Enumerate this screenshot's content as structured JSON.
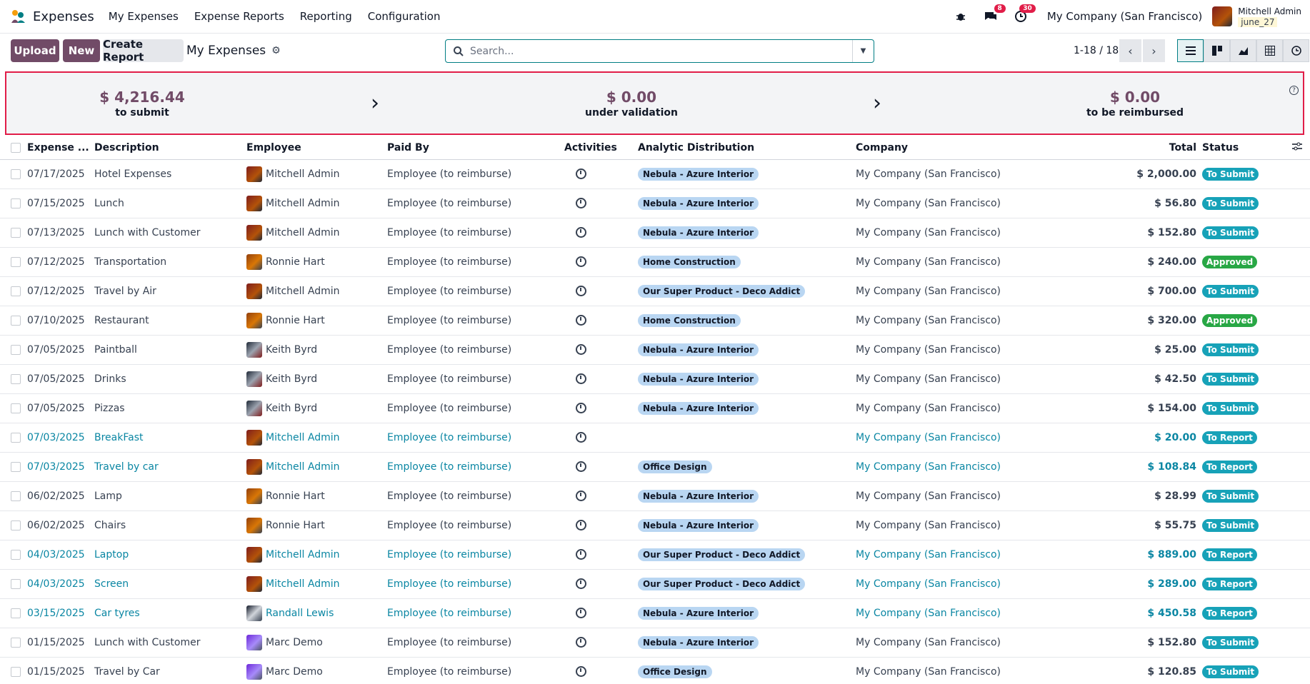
{
  "nav": {
    "app_name": "Expenses",
    "menu": [
      "My Expenses",
      "Expense Reports",
      "Reporting",
      "Configuration"
    ],
    "chat_badge": "8",
    "activity_badge": "30",
    "company": "My Company (San Francisco)",
    "user_name": "Mitchell Admin",
    "user_db": "june_27"
  },
  "control": {
    "upload_label": "Upload",
    "new_label": "New",
    "create_report_label": "Create Report",
    "breadcrumb": "My Expenses",
    "search_placeholder": "Search...",
    "pager": "1-18 / 18"
  },
  "summary": {
    "to_submit_amount": "$ 4,216.44",
    "to_submit_label": "to submit",
    "under_validation_amount": "$ 0.00",
    "under_validation_label": "under validation",
    "to_reimburse_amount": "$ 0.00",
    "to_reimburse_label": "to be reimbursed"
  },
  "table": {
    "headers": [
      "Expense ...",
      "Description",
      "Employee",
      "Paid By",
      "Activities",
      "Analytic Distribution",
      "Company",
      "Total",
      "Status"
    ],
    "rows": [
      {
        "date": "07/17/2025",
        "desc": "Hotel Expenses",
        "employee": "Mitchell Admin",
        "paid_by": "Employee (to reimburse)",
        "analytic": "Nebula - Azure Interior",
        "company": "My Company (San Francisco)",
        "total": "$ 2,000.00",
        "status": "To Submit"
      },
      {
        "date": "07/15/2025",
        "desc": "Lunch",
        "employee": "Mitchell Admin",
        "paid_by": "Employee (to reimburse)",
        "analytic": "Nebula - Azure Interior",
        "company": "My Company (San Francisco)",
        "total": "$ 56.80",
        "status": "To Submit"
      },
      {
        "date": "07/13/2025",
        "desc": "Lunch with Customer",
        "employee": "Mitchell Admin",
        "paid_by": "Employee (to reimburse)",
        "analytic": "Nebula - Azure Interior",
        "company": "My Company (San Francisco)",
        "total": "$ 152.80",
        "status": "To Submit"
      },
      {
        "date": "07/12/2025",
        "desc": "Transportation",
        "employee": "Ronnie Hart",
        "paid_by": "Employee (to reimburse)",
        "analytic": "Home Construction",
        "company": "My Company (San Francisco)",
        "total": "$ 240.00",
        "status": "Approved"
      },
      {
        "date": "07/12/2025",
        "desc": "Travel by Air",
        "employee": "Mitchell Admin",
        "paid_by": "Employee (to reimburse)",
        "analytic": "Our Super Product - Deco Addict",
        "company": "My Company (San Francisco)",
        "total": "$ 700.00",
        "status": "To Submit"
      },
      {
        "date": "07/10/2025",
        "desc": "Restaurant",
        "employee": "Ronnie Hart",
        "paid_by": "Employee (to reimburse)",
        "analytic": "Home Construction",
        "company": "My Company (San Francisco)",
        "total": "$ 320.00",
        "status": "Approved"
      },
      {
        "date": "07/05/2025",
        "desc": "Paintball",
        "employee": "Keith Byrd",
        "paid_by": "Employee (to reimburse)",
        "analytic": "Nebula - Azure Interior",
        "company": "My Company (San Francisco)",
        "total": "$ 25.00",
        "status": "To Submit"
      },
      {
        "date": "07/05/2025",
        "desc": "Drinks",
        "employee": "Keith Byrd",
        "paid_by": "Employee (to reimburse)",
        "analytic": "Nebula - Azure Interior",
        "company": "My Company (San Francisco)",
        "total": "$ 42.50",
        "status": "To Submit"
      },
      {
        "date": "07/05/2025",
        "desc": "Pizzas",
        "employee": "Keith Byrd",
        "paid_by": "Employee (to reimburse)",
        "analytic": "Nebula - Azure Interior",
        "company": "My Company (San Francisco)",
        "total": "$ 154.00",
        "status": "To Submit"
      },
      {
        "date": "07/03/2025",
        "desc": "BreakFast",
        "employee": "Mitchell Admin",
        "paid_by": "Employee (to reimburse)",
        "analytic": "",
        "company": "My Company (San Francisco)",
        "total": "$ 20.00",
        "status": "To Report"
      },
      {
        "date": "07/03/2025",
        "desc": "Travel by car",
        "employee": "Mitchell Admin",
        "paid_by": "Employee (to reimburse)",
        "analytic": "Office Design",
        "company": "My Company (San Francisco)",
        "total": "$ 108.84",
        "status": "To Report"
      },
      {
        "date": "06/02/2025",
        "desc": "Lamp",
        "employee": "Ronnie Hart",
        "paid_by": "Employee (to reimburse)",
        "analytic": "Nebula - Azure Interior",
        "company": "My Company (San Francisco)",
        "total": "$ 28.99",
        "status": "To Submit"
      },
      {
        "date": "06/02/2025",
        "desc": "Chairs",
        "employee": "Ronnie Hart",
        "paid_by": "Employee (to reimburse)",
        "analytic": "Nebula - Azure Interior",
        "company": "My Company (San Francisco)",
        "total": "$ 55.75",
        "status": "To Submit"
      },
      {
        "date": "04/03/2025",
        "desc": "Laptop",
        "employee": "Mitchell Admin",
        "paid_by": "Employee (to reimburse)",
        "analytic": "Our Super Product - Deco Addict",
        "company": "My Company (San Francisco)",
        "total": "$ 889.00",
        "status": "To Report"
      },
      {
        "date": "04/03/2025",
        "desc": "Screen",
        "employee": "Mitchell Admin",
        "paid_by": "Employee (to reimburse)",
        "analytic": "Our Super Product - Deco Addict",
        "company": "My Company (San Francisco)",
        "total": "$ 289.00",
        "status": "To Report"
      },
      {
        "date": "03/15/2025",
        "desc": "Car tyres",
        "employee": "Randall Lewis",
        "paid_by": "Employee (to reimburse)",
        "analytic": "Nebula - Azure Interior",
        "company": "My Company (San Francisco)",
        "total": "$ 450.58",
        "status": "To Report"
      },
      {
        "date": "01/15/2025",
        "desc": "Lunch with Customer",
        "employee": "Marc Demo",
        "paid_by": "Employee (to reimburse)",
        "analytic": "Nebula - Azure Interior",
        "company": "My Company (San Francisco)",
        "total": "$ 152.80",
        "status": "To Submit"
      },
      {
        "date": "01/15/2025",
        "desc": "Travel by Car",
        "employee": "Marc Demo",
        "paid_by": "Employee (to reimburse)",
        "analytic": "Office Design",
        "company": "My Company (San Francisco)",
        "total": "$ 120.85",
        "status": "To Submit"
      }
    ]
  },
  "colors": {
    "primary": "#714b67",
    "teal": "#0a86a3",
    "status_to_submit": "#17a2b8",
    "status_approved": "#28a745",
    "highlight_border": "#e11d48"
  }
}
